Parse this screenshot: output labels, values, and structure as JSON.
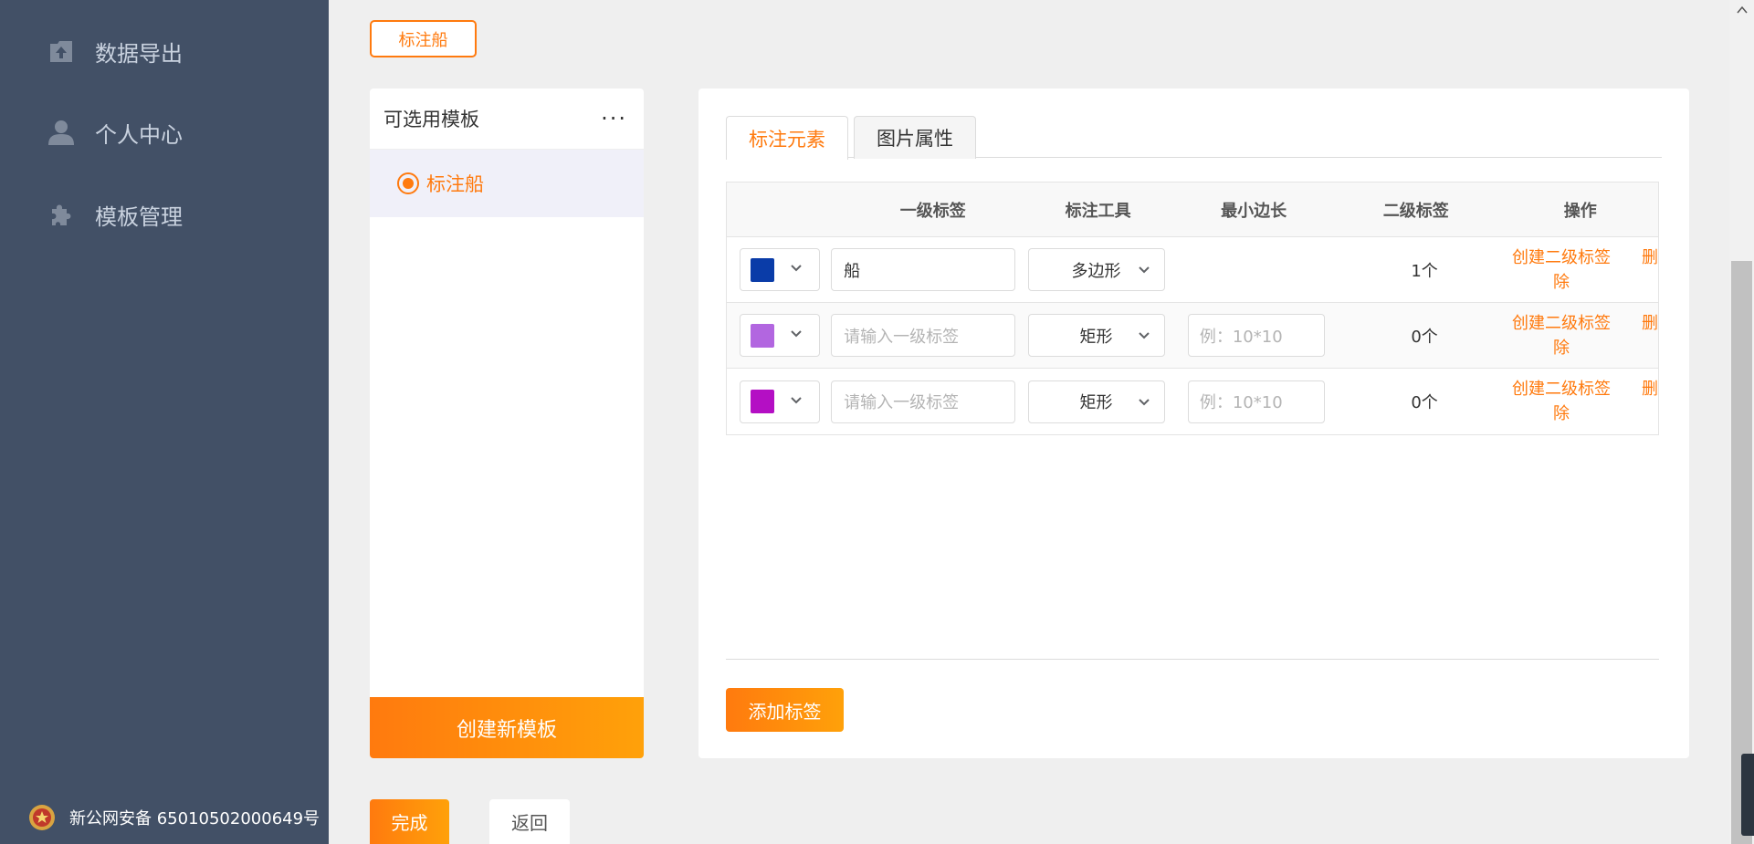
{
  "sidebar": {
    "items": [
      {
        "label": "数据导出",
        "icon": "upload-icon"
      },
      {
        "label": "个人中心",
        "icon": "user-icon"
      },
      {
        "label": "模板管理",
        "icon": "puzzle-icon"
      }
    ],
    "police_record": "新公网安备 65010502000649号"
  },
  "top_tag": "标注船",
  "templates": {
    "title": "可选用模板",
    "more": "···",
    "items": [
      {
        "label": "标注船",
        "selected": true
      }
    ],
    "create_label": "创建新模板"
  },
  "editor": {
    "tabs": [
      {
        "label": "标注元素",
        "active": true
      },
      {
        "label": "图片属性",
        "active": false
      }
    ],
    "columns": [
      "",
      "一级标签",
      "标注工具",
      "最小边长",
      "二级标签",
      "操作"
    ],
    "rows": [
      {
        "color": "#0a3ca8",
        "label": "船",
        "label_placeholder": "请输入一级标签",
        "tool": "多边形",
        "minlen_placeholder": "",
        "sub_count": "1个",
        "op_create": "创建二级标签",
        "op_create_tail": "除",
        "op_delete": "删"
      },
      {
        "color": "#b266e0",
        "label": "",
        "label_placeholder": "请输入一级标签",
        "tool": "矩形",
        "minlen_placeholder": "例：10*10",
        "sub_count": "0个",
        "op_create": "创建二级标签",
        "op_create_tail": "除",
        "op_delete": "删"
      },
      {
        "color": "#b40fc4",
        "label": "",
        "label_placeholder": "请输入一级标签",
        "tool": "矩形",
        "minlen_placeholder": "例：10*10",
        "sub_count": "0个",
        "op_create": "创建二级标签",
        "op_create_tail": "除",
        "op_delete": "删"
      }
    ],
    "add_label": "添加标签"
  },
  "footer": {
    "done": "完成",
    "back": "返回"
  },
  "colors": {
    "accent": "#ff7a0e",
    "sidebar_bg": "#425066"
  }
}
